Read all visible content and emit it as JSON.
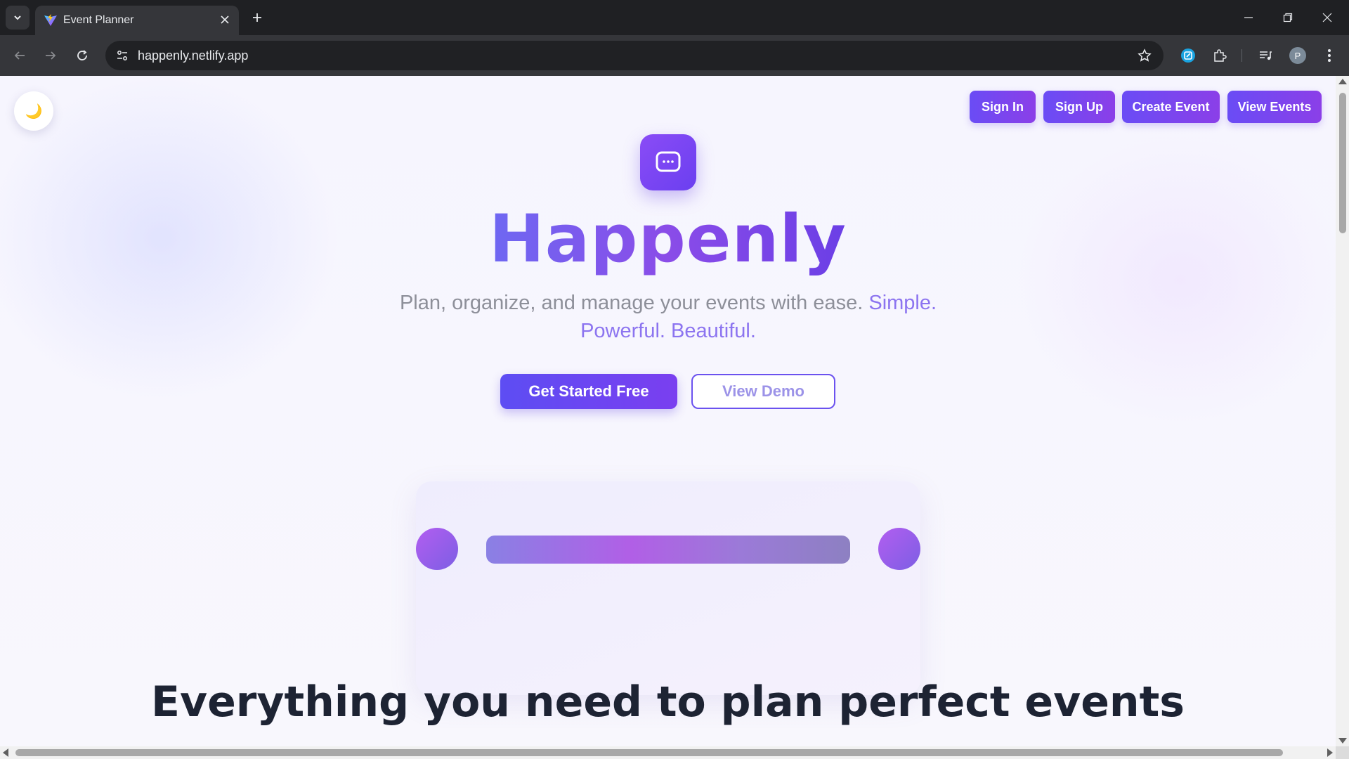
{
  "browser": {
    "tab_title": "Event Planner",
    "url": "happenly.netlify.app",
    "profile_initial": "P",
    "icons": {
      "tab_search": "chevron-down-icon",
      "favicon": "vite-logo-icon",
      "close_tab": "close-icon",
      "new_tab": "plus-icon",
      "back": "arrow-left-icon",
      "forward": "arrow-right-icon",
      "reload": "reload-icon",
      "site_info": "tune-icon",
      "bookmark": "star-icon",
      "extension_a": "extension-badge-icon",
      "extensions": "puzzle-icon",
      "media": "playlist-icon",
      "menu": "kebab-menu-icon",
      "minimize": "minimize-icon",
      "restore": "restore-icon",
      "close_window": "close-icon"
    }
  },
  "page": {
    "theme_toggle_icon": "🌙",
    "nav": {
      "sign_in": "Sign In",
      "sign_up": "Sign Up",
      "create_event": "Create Event",
      "view_events": "View Events"
    },
    "hero": {
      "brand": "Happenly",
      "tagline_plain": "Plan, organize, and manage your events with ease.",
      "tagline_accent_1": "Simple.",
      "tagline_accent_2": "Powerful.",
      "tagline_accent_3": "Beautiful.",
      "cta_primary": "Get Started Free",
      "cta_secondary": "View Demo"
    },
    "features_heading": "Everything you need to plan perfect events"
  },
  "colors": {
    "brand_gradient_start": "#6a4cf5",
    "brand_gradient_end": "#8b3fe8",
    "heading_dark": "#1d2333",
    "tagline_gray": "#8d8f99",
    "tagline_accent": "#8c74f0"
  }
}
